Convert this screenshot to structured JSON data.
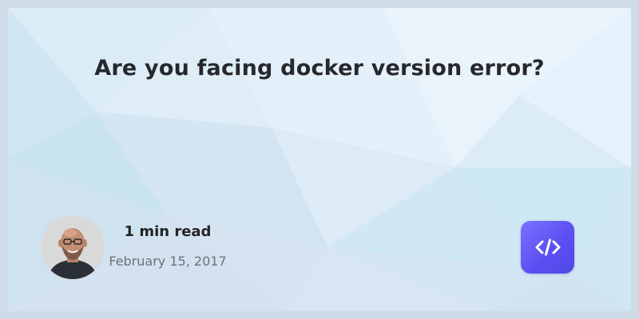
{
  "post": {
    "title": "Are you facing docker version error?",
    "read_time": "1 min read",
    "date": "February 15, 2017"
  },
  "author": {
    "avatar_icon": "author-avatar"
  },
  "badge": {
    "icon": "code-icon",
    "color": "#6b62f5"
  },
  "colors": {
    "frame": "#cfdbe6",
    "title": "#26282c",
    "date": "#6e7176"
  }
}
